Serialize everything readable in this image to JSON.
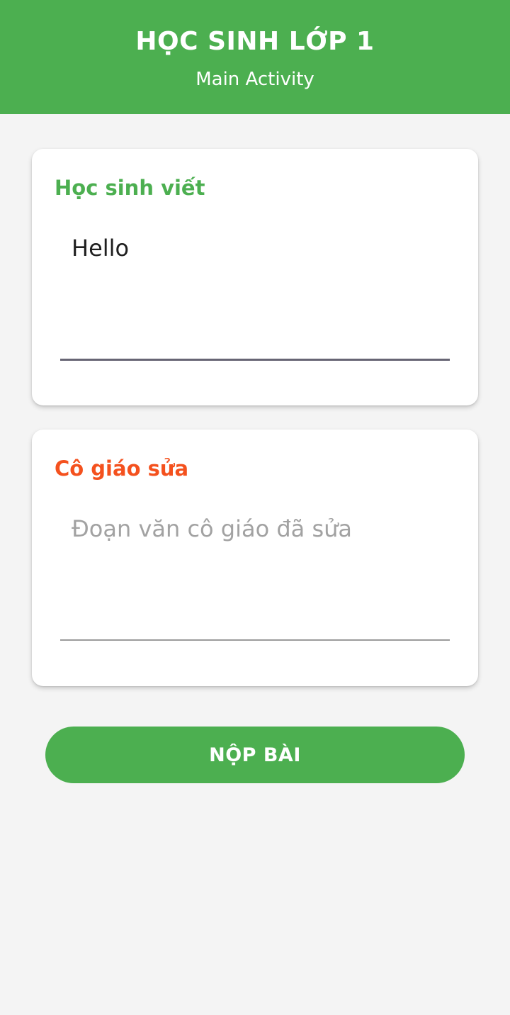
{
  "app_bar": {
    "title": "HỌC SINH LỚP 1",
    "subtitle": "Main Activity"
  },
  "student_card": {
    "label": "Học sinh viết",
    "value": "Hello",
    "placeholder": ""
  },
  "teacher_card": {
    "label": "Cô giáo sửa",
    "value": "",
    "placeholder": "Đoạn văn cô giáo đã sửa"
  },
  "submit_button": {
    "label": "NỘP BÀI"
  },
  "colors": {
    "primary": "#4caf50",
    "accent": "#f4511e",
    "background": "#f4f4f4",
    "card": "#ffffff"
  }
}
